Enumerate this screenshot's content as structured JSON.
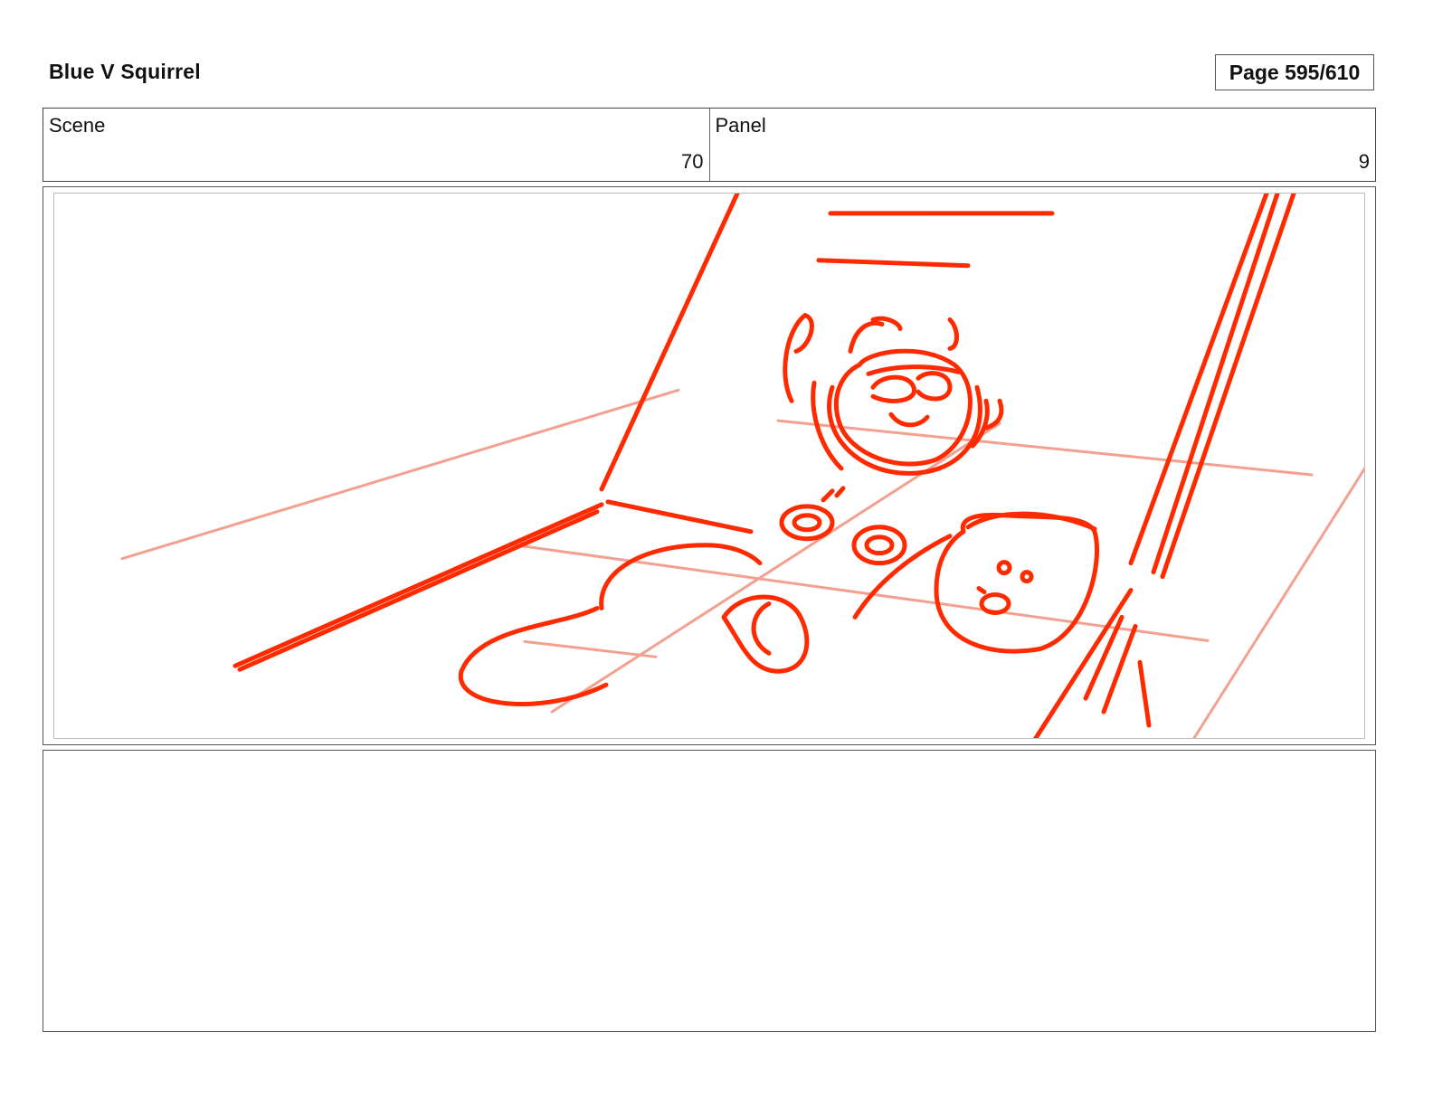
{
  "header": {
    "project_title": "Blue V Squirrel",
    "page_label": "Page 595/610"
  },
  "meta": {
    "scene_label": "Scene",
    "scene_value": "70",
    "panel_label": "Panel",
    "panel_value": "9"
  },
  "panel": {
    "sketch_color": "#ff2a00",
    "guide_color": "#f4a090"
  },
  "notes": {
    "text": ""
  }
}
